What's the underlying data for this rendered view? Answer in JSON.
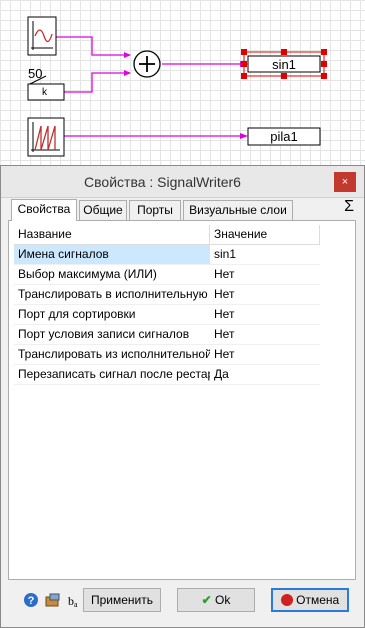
{
  "diagram": {
    "const_value": "50",
    "k_label": "k",
    "sum_symbol": "+",
    "writer1_label": "sin1",
    "writer2_label": "pila1"
  },
  "dialog": {
    "title": "Свойства : SignalWriter6",
    "close_label": "×",
    "sigma": "Σ",
    "tabs": [
      "Свойства",
      "Общие",
      "Порты",
      "Визуальные слои"
    ],
    "columns": [
      "Название",
      "Значение"
    ],
    "rows": [
      {
        "name": "Имена сигналов",
        "value": "sin1"
      },
      {
        "name": "Выбор максимума (ИЛИ)",
        "value": "Нет"
      },
      {
        "name": "Транслировать в исполнительную систему",
        "value": "Нет"
      },
      {
        "name": "Порт для сортировки",
        "value": "Нет"
      },
      {
        "name": "Порт условия записи сигналов",
        "value": "Нет"
      },
      {
        "name": "Транслировать из исполнительной системы",
        "value": "Нет"
      },
      {
        "name": "Перезаписать сигнал после рестарта",
        "value": "Да"
      }
    ],
    "buttons": {
      "apply": "Применить",
      "ok": "Ok",
      "cancel": "Отмена"
    }
  },
  "colors": {
    "connector": "#e000e0",
    "selection": "#e00000",
    "ok_check": "#2e9e2e",
    "cancel_icon": "#d02020"
  }
}
